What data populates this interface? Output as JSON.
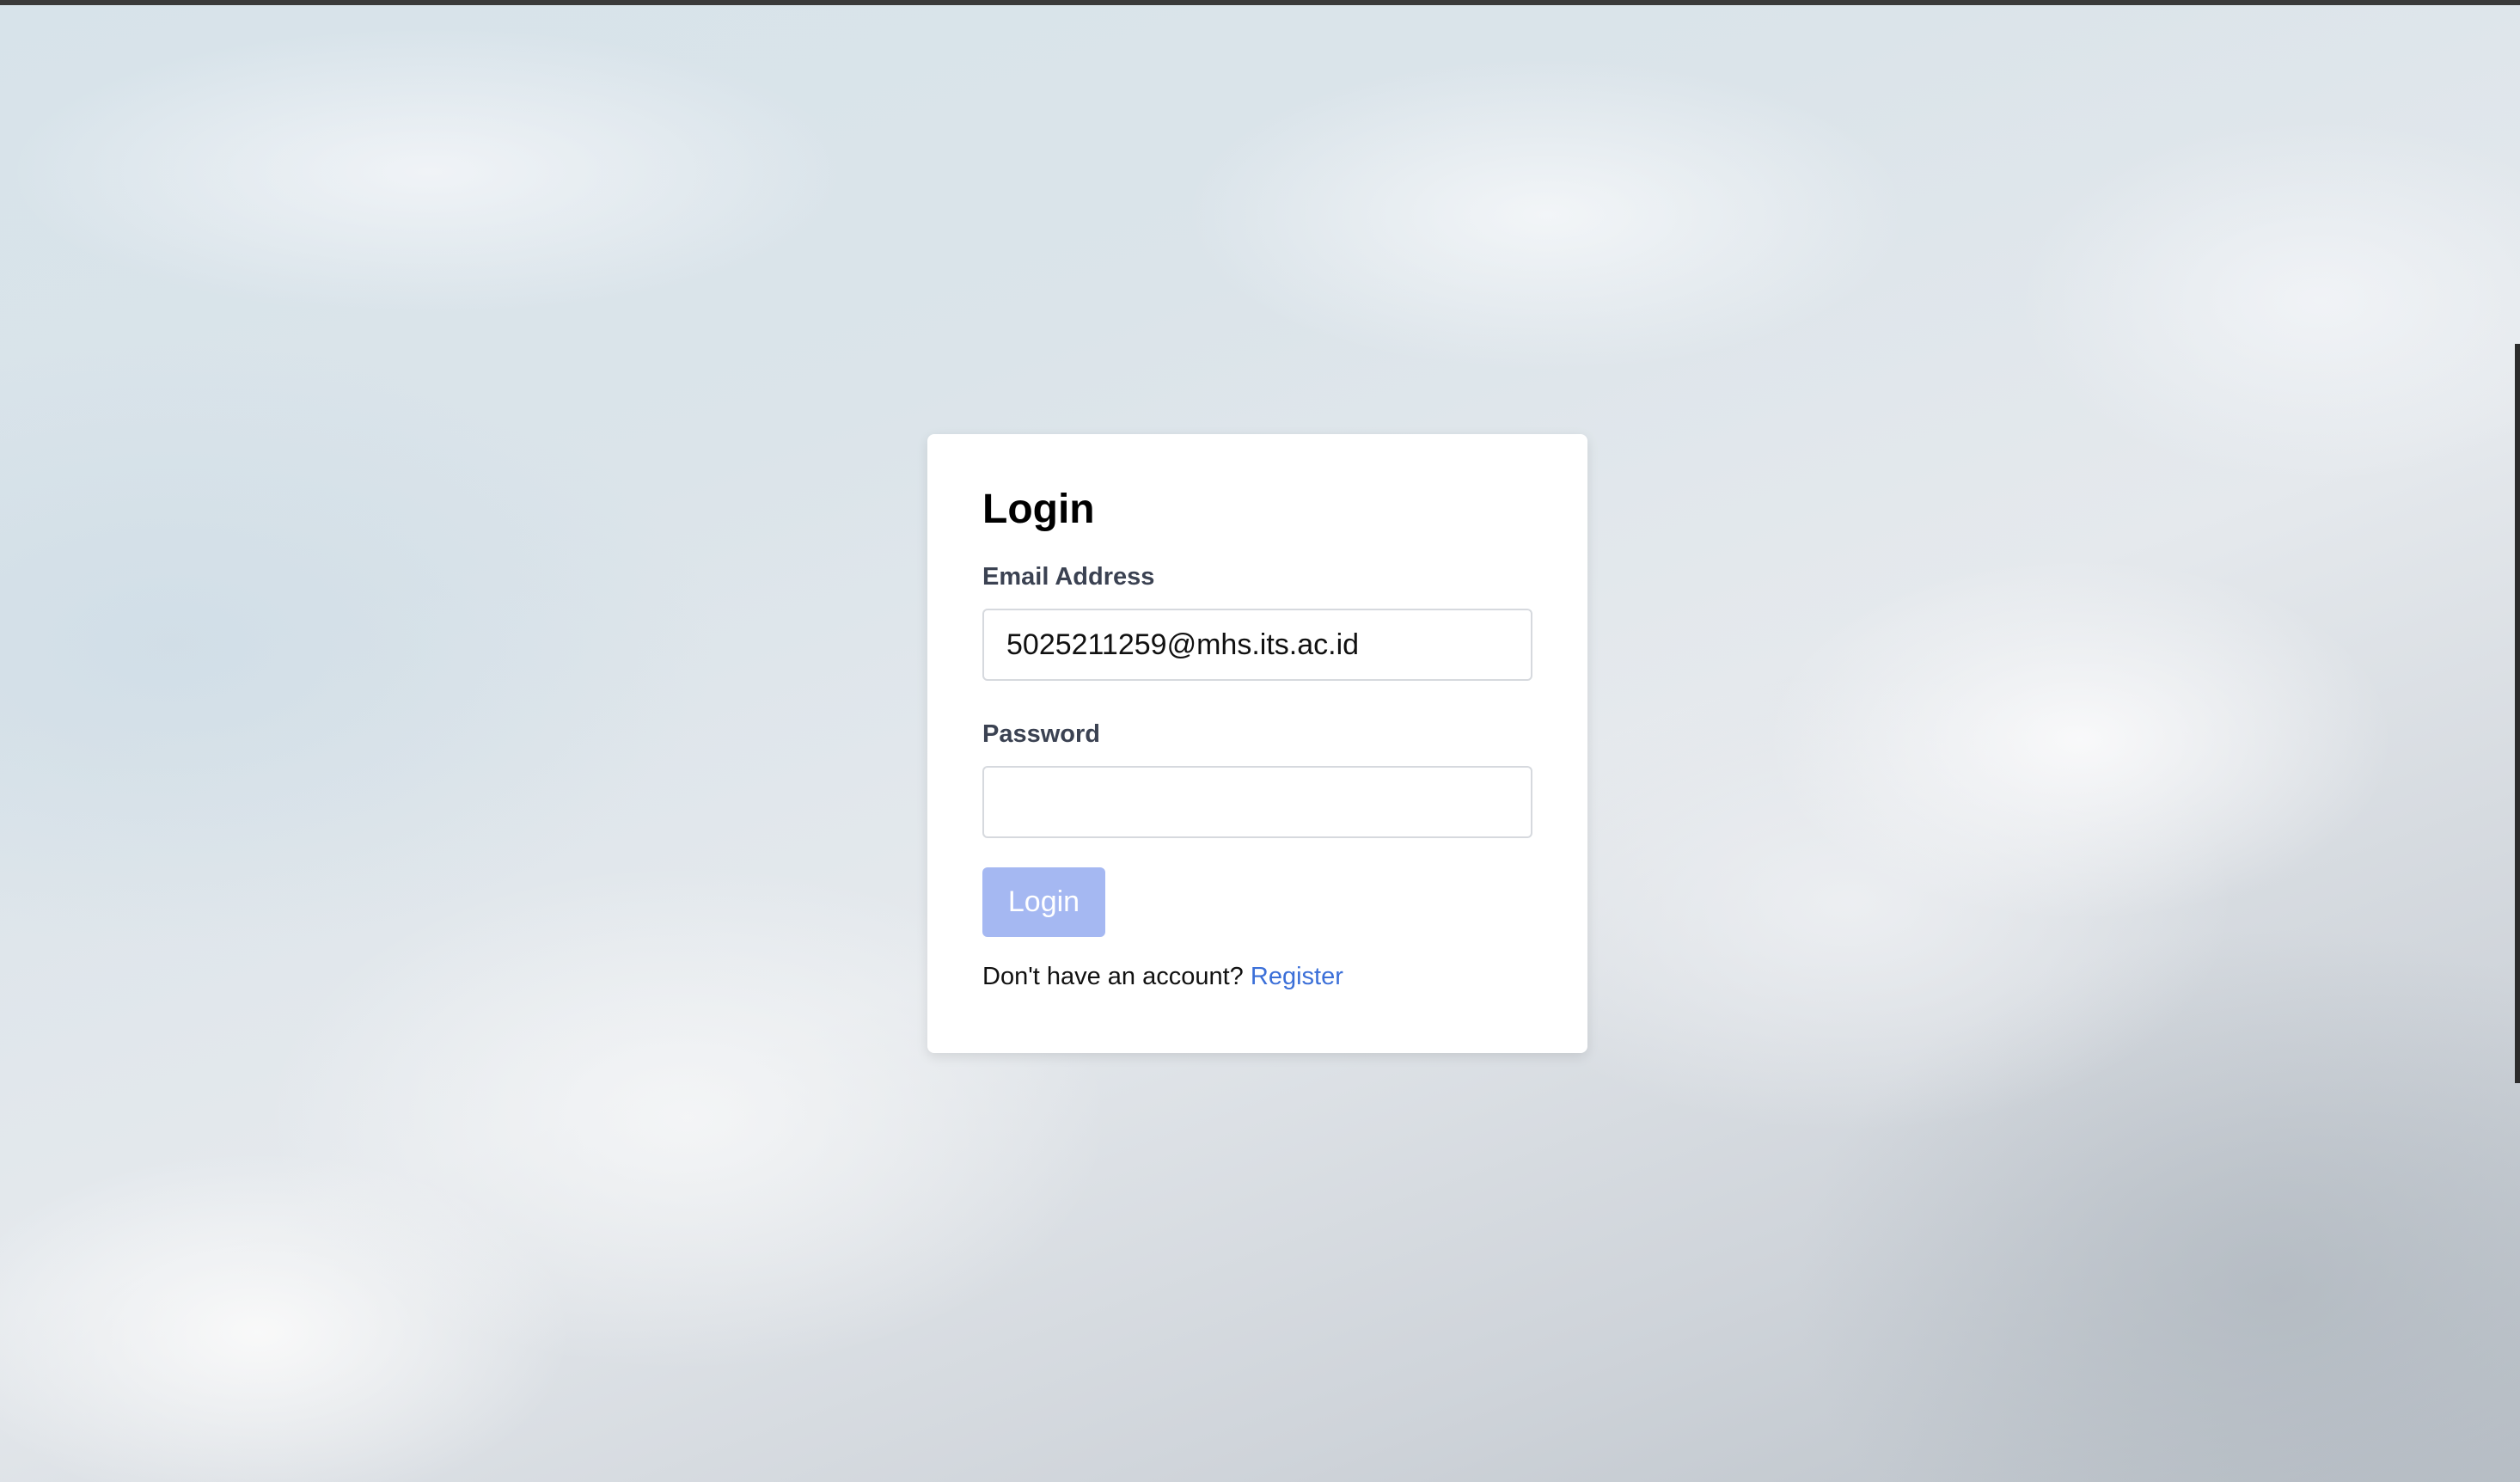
{
  "login": {
    "title": "Login",
    "email_label": "Email Address",
    "email_value": "5025211259@mhs.its.ac.id",
    "password_label": "Password",
    "password_value": "",
    "submit_label": "Login",
    "footer_text": "Don't have an account?",
    "register_link": "Register"
  },
  "colors": {
    "button_bg": "#a5b8f2",
    "link": "#3b6fd8",
    "card_bg": "#ffffff"
  }
}
